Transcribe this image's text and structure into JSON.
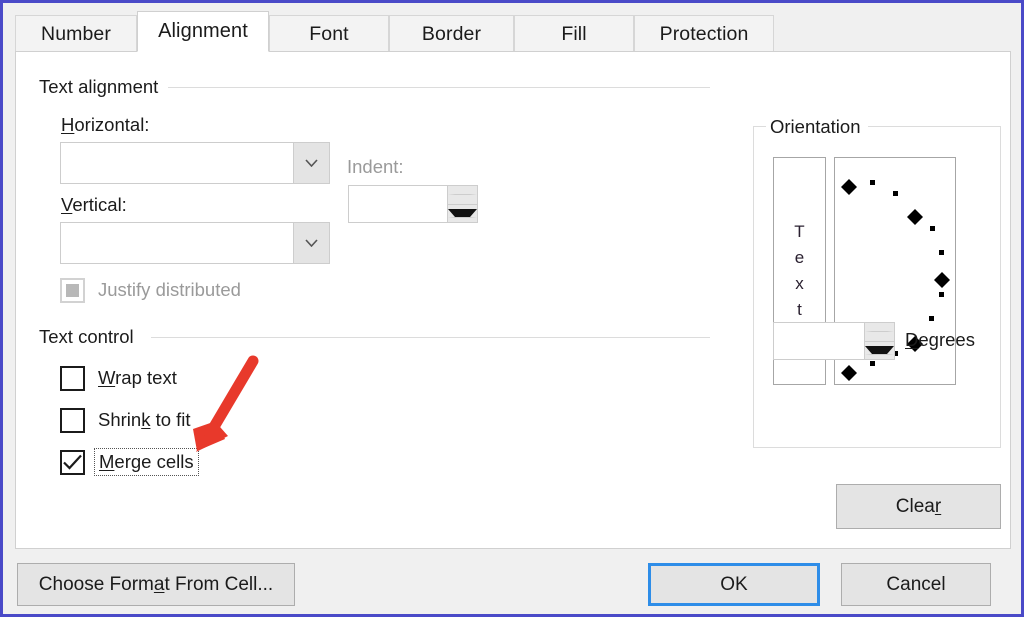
{
  "dialog": {
    "accent_focus_color": "#2e8de8",
    "window_border_color": "#4a4ac8",
    "tabs": [
      {
        "label": "Number",
        "active": false
      },
      {
        "label": "Alignment",
        "active": true
      },
      {
        "label": "Font",
        "active": false
      },
      {
        "label": "Border",
        "active": false
      },
      {
        "label": "Fill",
        "active": false
      },
      {
        "label": "Protection",
        "active": false
      }
    ]
  },
  "text_alignment": {
    "group_label": "Text alignment",
    "horizontal": {
      "label_pre": "H",
      "label_post": "orizontal:",
      "value": "",
      "dropdown_icon": "chevron-down-icon"
    },
    "vertical": {
      "label_pre": "V",
      "label_post": "ertical:",
      "value": "",
      "dropdown_icon": "chevron-down-icon"
    },
    "indent": {
      "label": "Indent:",
      "value": "",
      "disabled": true
    },
    "justify_distributed": {
      "label": "Justify distributed",
      "checked": false,
      "disabled": true
    }
  },
  "text_control": {
    "group_label": "Text control",
    "items": [
      {
        "label_pre": "W",
        "label_mid": "rap text",
        "label_post": "",
        "checked": false,
        "focused": false
      },
      {
        "label_pre": "Shrin",
        "label_mid": "k",
        "label_post": " to fit",
        "checked": false,
        "focused": false
      },
      {
        "label_pre": "M",
        "label_mid": "erge cells",
        "label_post": "",
        "checked": true,
        "focused": true
      }
    ]
  },
  "orientation": {
    "group_label": "Orientation",
    "preview_text_letters": [
      "T",
      "e",
      "x",
      "t"
    ],
    "degrees": {
      "value": "",
      "label_pre": "D",
      "label_post": "egrees"
    },
    "spinner_up_icon": "triangle-up-icon",
    "spinner_down_icon": "triangle-down-icon"
  },
  "buttons": {
    "clear": {
      "label_pre": "Clea",
      "label_mid": "r",
      "label_post": ""
    },
    "choose_format": {
      "label_pre": "Choose Form",
      "label_mid": "a",
      "label_post": "t From Cell..."
    },
    "ok": {
      "label": "OK",
      "is_default": true
    },
    "cancel": {
      "label": "Cancel",
      "is_default": false
    }
  },
  "annotation": {
    "arrow_color": "#e8392b",
    "points_to": "merge-cells-checkbox"
  }
}
